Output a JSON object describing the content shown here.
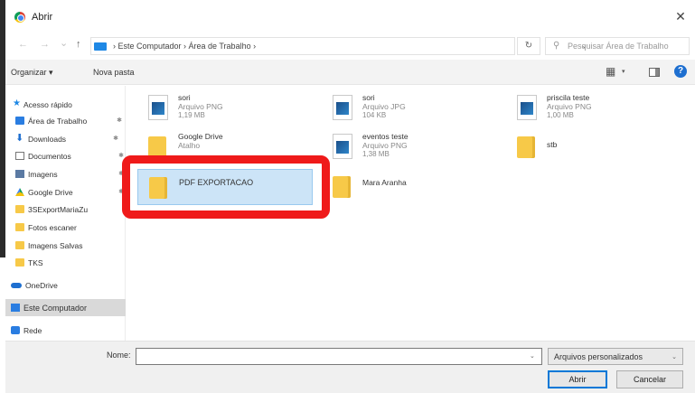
{
  "window": {
    "title": "Abrir",
    "close_glyph": "✕"
  },
  "nav": {
    "back": "←",
    "forward": "→",
    "recent": "⌄",
    "up": "↑",
    "path": "›  Este Computador  ›  Área de Trabalho  ›",
    "dropdown": "⌄",
    "refresh": "↻",
    "search_placeholder": "Pesquisar Área de Trabalho"
  },
  "toolbar": {
    "organize": "Organizar ▾",
    "new_folder": "Nova pasta",
    "view_glyph": "▦",
    "view_arrow": "▾",
    "help": "?"
  },
  "sidebar": {
    "items": [
      {
        "label": "Acesso rápido",
        "icon": "star-icon"
      },
      {
        "label": "Área de Trabalho",
        "icon": "desktop-folder-icon",
        "pinned": "✱"
      },
      {
        "label": "Downloads",
        "icon": "download-icon",
        "pinned": "✱"
      },
      {
        "label": "Documentos",
        "icon": "document-icon",
        "pinned": "✱"
      },
      {
        "label": "Imagens",
        "icon": "pictures-icon",
        "pinned": "✱"
      },
      {
        "label": "Google Drive",
        "icon": "google-drive-icon",
        "pinned": "✱"
      },
      {
        "label": "3SExportMariaZu",
        "icon": "folder-icon"
      },
      {
        "label": "Fotos escaner",
        "icon": "folder-icon"
      },
      {
        "label": "Imagens Salvas",
        "icon": "folder-icon"
      },
      {
        "label": "TKS",
        "icon": "folder-icon"
      },
      {
        "label": "OneDrive",
        "icon": "onedrive-icon"
      },
      {
        "label": "Este Computador",
        "icon": "computer-icon"
      },
      {
        "label": "Rede",
        "icon": "network-icon"
      }
    ]
  },
  "files": [
    {
      "name": "sori",
      "type": "Arquivo PNG",
      "size": "1,19 MB",
      "icon": "image-file-icon"
    },
    {
      "name": "sori",
      "type": "Arquivo JPG",
      "size": "104 KB",
      "icon": "image-file-icon"
    },
    {
      "name": "priscila teste",
      "type": "Arquivo PNG",
      "size": "1,00 MB",
      "icon": "image-file-icon"
    },
    {
      "name": "Google Drive",
      "type": "Atalho",
      "size": "",
      "icon": "google-drive-shortcut-icon"
    },
    {
      "name": "eventos teste",
      "type": "Arquivo PNG",
      "size": "1,38 MB",
      "icon": "image-file-icon"
    },
    {
      "name": "stb",
      "type": "",
      "size": "",
      "icon": "folder-icon"
    },
    {
      "name": "PDF EXPORTACAO",
      "type": "",
      "size": "",
      "icon": "folder-icon",
      "selected": true
    },
    {
      "name": "Mara Aranha",
      "type": "",
      "size": "",
      "icon": "folder-icon"
    }
  ],
  "footer": {
    "name_label": "Nome:",
    "name_value": "",
    "name_dropdown": "⌄",
    "filetype": "Arquivos personalizados",
    "filetype_arrow": "⌄",
    "open": "Abrir",
    "cancel": "Cancelar"
  },
  "colors": {
    "highlight": "#ef1a1a",
    "selection": "#cce4f7",
    "accent": "#0078d7"
  }
}
